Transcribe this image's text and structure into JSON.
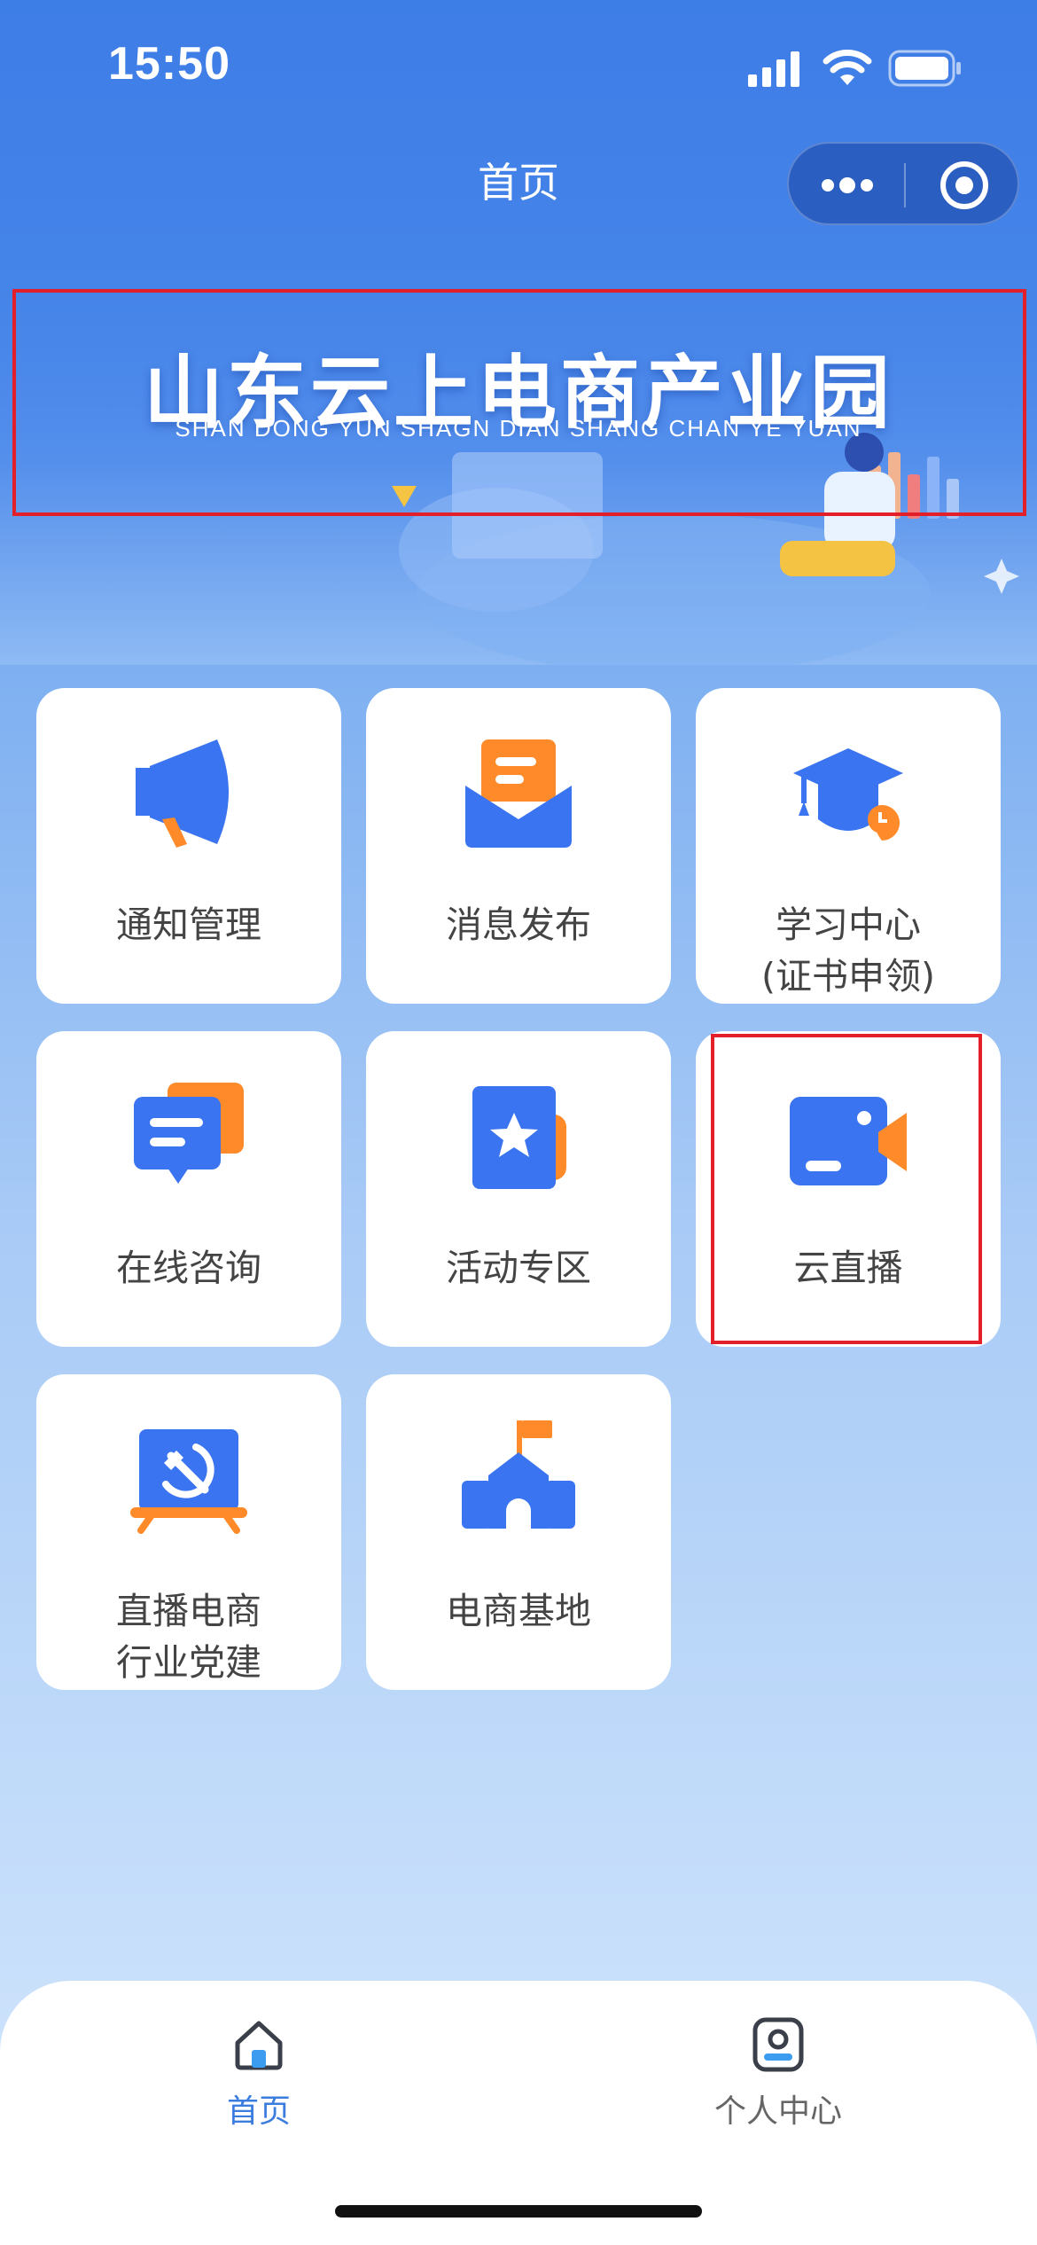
{
  "status_bar": {
    "time": "15:50"
  },
  "nav": {
    "title": "首页"
  },
  "banner": {
    "title": "山东云上电商产业园",
    "subtitle": "SHAN DONG YUN SHAGN DIAN SHANG CHAN YE YUAN"
  },
  "grid": [
    {
      "label": "通知管理",
      "icon": "megaphone-icon"
    },
    {
      "label": "消息发布",
      "icon": "envelope-icon"
    },
    {
      "label": "学习中心\n(证书申领)",
      "icon": "graduation-cap-icon"
    },
    {
      "label": "在线咨询",
      "icon": "chat-bubbles-icon"
    },
    {
      "label": "活动专区",
      "icon": "star-document-icon"
    },
    {
      "label": "云直播",
      "icon": "video-camera-icon"
    },
    {
      "label": "直播电商\n行业党建",
      "icon": "party-emblem-icon"
    },
    {
      "label": "电商基地",
      "icon": "school-building-icon"
    }
  ],
  "tabbar": {
    "items": [
      {
        "label": "首页",
        "icon": "home-icon",
        "active": true
      },
      {
        "label": "个人中心",
        "icon": "user-card-icon",
        "active": false
      }
    ]
  },
  "colors": {
    "accent_blue": "#3b74f0",
    "accent_orange": "#ff8a2a",
    "highlight_red": "#e3202a",
    "active_tab": "#3b7ddf",
    "inactive_tab": "#666666"
  }
}
